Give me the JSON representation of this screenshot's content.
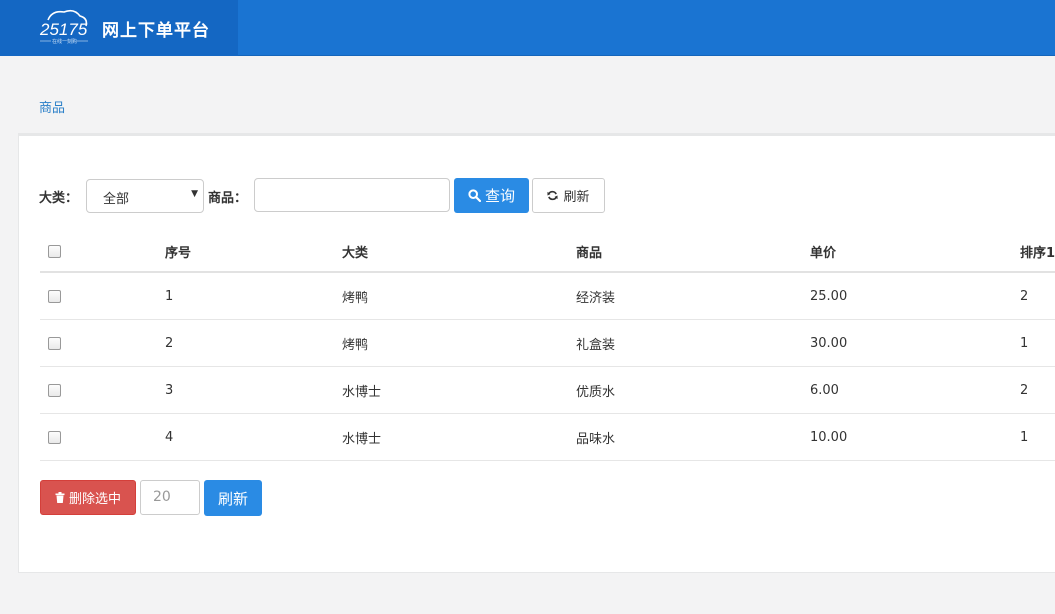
{
  "header": {
    "logo_text": "25175",
    "logo_tagline": "在线一刻购",
    "title": "网上下单平台"
  },
  "breadcrumb": "商品",
  "filters": {
    "category_label": "大类：",
    "category_selected": "全部",
    "product_label": "商品：",
    "product_value": "",
    "query_button": "查询",
    "refresh_button": "刷新"
  },
  "table": {
    "columns": [
      "序号",
      "大类",
      "商品",
      "单价",
      "排序1"
    ],
    "rows": [
      {
        "index": "1",
        "category": "烤鸭",
        "product": "经济装",
        "price": "25.00",
        "sort": "2"
      },
      {
        "index": "2",
        "category": "烤鸭",
        "product": "礼盒装",
        "price": "30.00",
        "sort": "1"
      },
      {
        "index": "3",
        "category": "水博士",
        "product": "优质水",
        "price": "6.00",
        "sort": "2"
      },
      {
        "index": "4",
        "category": "水博士",
        "product": "品味水",
        "price": "10.00",
        "sort": "1"
      }
    ]
  },
  "footer": {
    "delete_button": "删除选中",
    "page_size": "20",
    "refresh_button": "刷新"
  },
  "colors": {
    "header_bg": "#1a74d2",
    "brand_bg": "#1467c3",
    "primary": "#2a8be4",
    "danger": "#d9534f",
    "link": "#2a7fc8"
  },
  "icons": {
    "query": "search-icon",
    "refresh": "refresh-icon",
    "delete": "trash-icon"
  }
}
